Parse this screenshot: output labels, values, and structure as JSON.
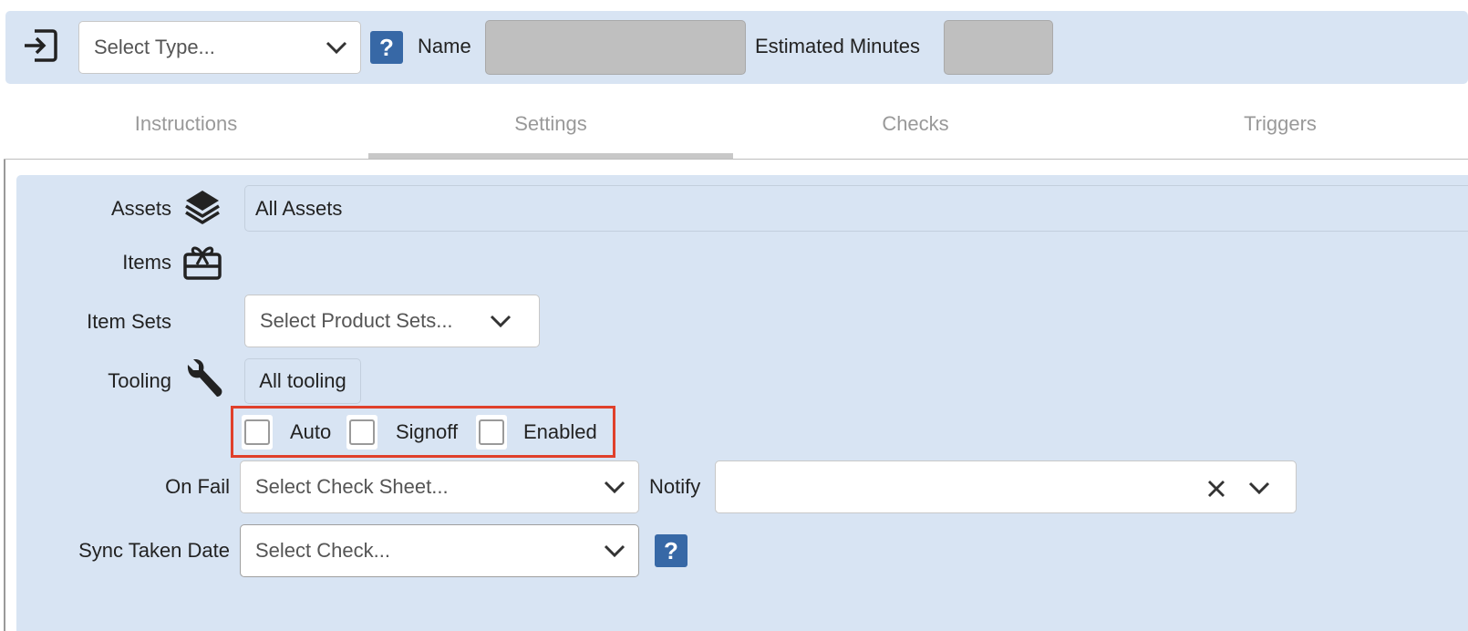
{
  "header": {
    "type_select": {
      "placeholder": "Select Type..."
    },
    "help_label": "?",
    "name_label": "Name",
    "name_value": "",
    "estimated_minutes_label": "Estimated Minutes",
    "estimated_minutes_value": ""
  },
  "tabs": [
    {
      "label": "Instructions",
      "active": false
    },
    {
      "label": "Settings",
      "active": true
    },
    {
      "label": "Checks",
      "active": false
    },
    {
      "label": "Triggers",
      "active": false
    }
  ],
  "settings": {
    "assets": {
      "label": "Assets",
      "value": "All Assets",
      "icon": "layers-icon"
    },
    "items": {
      "label": "Items",
      "icon": "gift-card-icon"
    },
    "item_sets": {
      "label": "Item Sets",
      "placeholder": "Select Product Sets..."
    },
    "tooling": {
      "label": "Tooling",
      "value": "All tooling",
      "icon": "wrench-icon"
    },
    "checkboxes": [
      {
        "label": "Auto",
        "checked": false
      },
      {
        "label": "Signoff",
        "checked": false
      },
      {
        "label": "Enabled",
        "checked": false
      }
    ],
    "on_fail": {
      "label": "On Fail",
      "placeholder": "Select Check Sheet..."
    },
    "notify": {
      "label": "Notify",
      "value": ""
    },
    "sync_taken_date": {
      "label": "Sync Taken Date",
      "placeholder": "Select Check..."
    },
    "help_label": "?"
  },
  "colors": {
    "panel_bg": "#d8e4f3",
    "help_button": "#3768a6",
    "highlight_border": "#e0402b"
  }
}
